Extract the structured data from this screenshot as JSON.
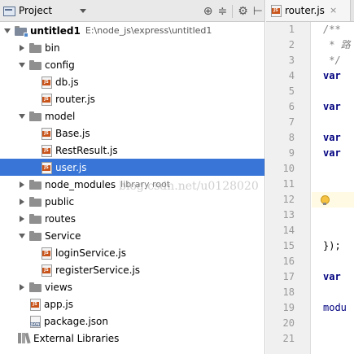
{
  "project_panel": {
    "title": "Project",
    "tools": {
      "settings_icon": "⊕",
      "collapse_icon": "≑",
      "gear_icon": "⚙",
      "hide_icon": "⊢"
    },
    "tree": {
      "root": {
        "name": "untitled1",
        "path": "E:\\node_js\\express\\untitled1"
      },
      "items": [
        {
          "label": "bin"
        },
        {
          "label": "config"
        },
        {
          "label": "db.js"
        },
        {
          "label": "router.js"
        },
        {
          "label": "model"
        },
        {
          "label": "Base.js"
        },
        {
          "label": "RestResult.js"
        },
        {
          "label": "user.js"
        },
        {
          "label": "node_modules",
          "suffix": "library root"
        },
        {
          "label": "public"
        },
        {
          "label": "routes"
        },
        {
          "label": "Service"
        },
        {
          "label": "loginService.js"
        },
        {
          "label": "registerService.js"
        },
        {
          "label": "views"
        },
        {
          "label": "app.js"
        },
        {
          "label": "package.json"
        },
        {
          "label": "External Libraries"
        }
      ]
    },
    "watermark": "blog.csdn.net/u0128020"
  },
  "editor": {
    "tab": {
      "label": "router.js",
      "close": "×"
    },
    "line_numbers": [
      "1",
      "2",
      "3",
      "4",
      "5",
      "6",
      "7",
      "8",
      "9",
      "10",
      "11",
      "12",
      "13",
      "14",
      "15",
      "16",
      "17",
      "18",
      "19",
      "20",
      "21"
    ],
    "lines": [
      {
        "text": "/**"
      },
      {
        "text": " * 路"
      },
      {
        "text": " */"
      },
      {
        "text": "var"
      },
      {
        "text": ""
      },
      {
        "text": "var"
      },
      {
        "text": ""
      },
      {
        "text": "var"
      },
      {
        "text": "var"
      },
      {
        "text": ""
      },
      {
        "text": ""
      },
      {
        "text": ""
      },
      {
        "text": ""
      },
      {
        "text": ""
      },
      {
        "text": "});"
      },
      {
        "text": ""
      },
      {
        "text": "var"
      },
      {
        "text": ""
      },
      {
        "text": "modu"
      },
      {
        "text": ""
      },
      {
        "text": ""
      }
    ]
  },
  "colors": {
    "selection": "#3875d7",
    "header_bg": "#e9e9e9",
    "gutter_bg": "#f0f0f0",
    "keyword": "#000080",
    "comment": "#808080",
    "js_badge": "#c9541b"
  }
}
